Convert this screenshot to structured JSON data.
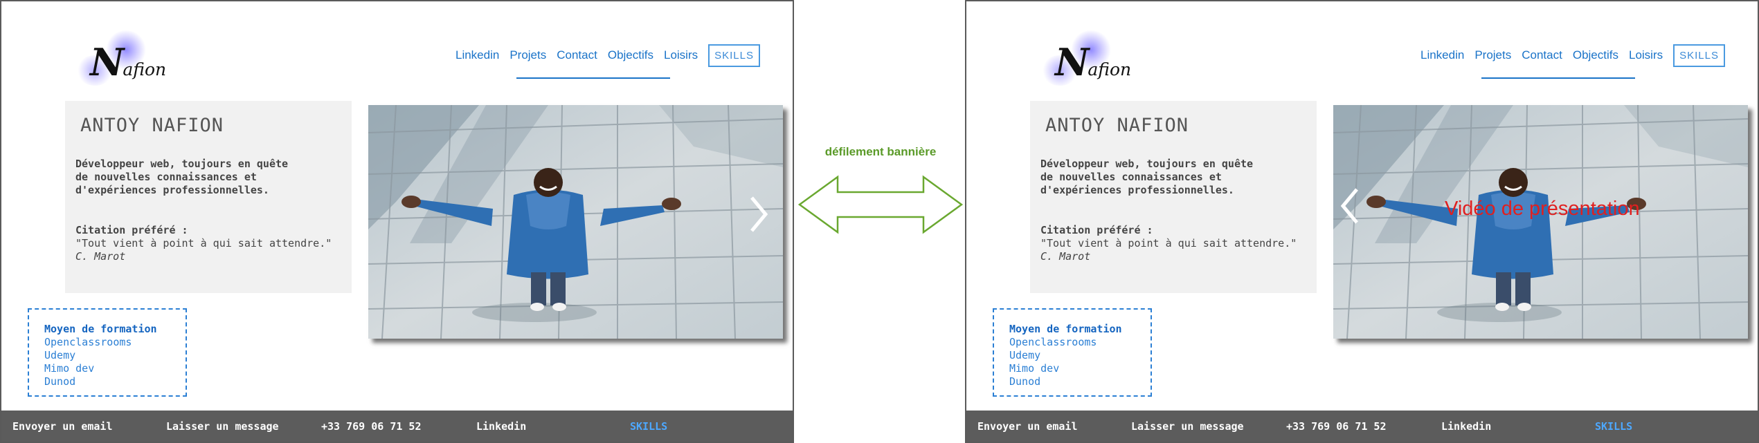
{
  "annotation": {
    "label": "défilement bannière"
  },
  "left_panel": {
    "logo": {
      "big": "N",
      "small": "afion"
    },
    "nav": {
      "items": [
        "Linkedin",
        "Projets",
        "Contact",
        "Objectifs",
        "Loisirs"
      ],
      "skills": "SKILLS"
    },
    "profile": {
      "name": "ANTOY NAFION",
      "bio": [
        "Développeur web, toujours en quête",
        "de nouvelles connaissances et",
        "d'expériences professionnelles."
      ],
      "quote_label": "Citation préféré :",
      "quote": "\"Tout vient à point à qui sait attendre.\"",
      "author": "C. Marot"
    },
    "formation": {
      "title": "Moyen de formation",
      "items": [
        "Openclassrooms",
        "Udemy",
        "Mimo dev",
        "Dunod"
      ]
    },
    "footer": {
      "email": "Envoyer un email",
      "message": "Laisser un message",
      "phone": "+33 769 06 71 52",
      "linkedin": "Linkedin",
      "skills": "SKILLS"
    }
  },
  "right_panel": {
    "logo": {
      "big": "N",
      "small": "afion"
    },
    "nav": {
      "items": [
        "Linkedin",
        "Projets",
        "Contact",
        "Objectifs",
        "Loisirs"
      ],
      "skills": "SKILLS"
    },
    "profile": {
      "name": "ANTOY NAFION",
      "bio": [
        "Développeur web, toujours en quête",
        "de nouvelles connaissances et",
        "d'expériences professionnelles."
      ],
      "quote_label": "Citation préféré :",
      "quote": "\"Tout vient à point à qui sait attendre.\"",
      "author": "C. Marot"
    },
    "banner": {
      "overlay_text": "Vidéo de présentation"
    },
    "formation": {
      "title": "Moyen de formation",
      "items": [
        "Openclassrooms",
        "Udemy",
        "Mimo dev",
        "Dunod"
      ]
    },
    "footer": {
      "email": "Envoyer un email",
      "message": "Laisser un message",
      "phone": "+33 769 06 71 52",
      "linkedin": "Linkedin",
      "skills": "SKILLS"
    }
  },
  "colors": {
    "accent": "#1a73c8",
    "footer_bg": "#5c5c5c",
    "footer_skills": "#4da8ff",
    "annotation": "#5a9a28",
    "video_text": "#e02020",
    "jacket": "#2f6fb3"
  }
}
